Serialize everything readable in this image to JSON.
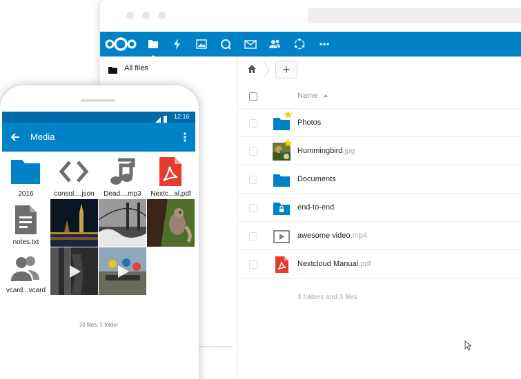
{
  "desktop": {
    "header_icons": [
      "nextcloud-logo",
      "files-icon",
      "activity-icon",
      "gallery-icon",
      "talk-icon",
      "mail-icon",
      "contacts-icon",
      "circles-icon",
      "more-icon"
    ],
    "sidebar": {
      "items": [
        {
          "label": "All files",
          "icon": "folder-icon"
        }
      ]
    },
    "controls": {
      "add_label": "+"
    },
    "file_list": {
      "name_column": "Name",
      "files": [
        {
          "name": "Photos",
          "ext": "",
          "type": "folder",
          "favorite": true
        },
        {
          "name": "Hummingbird",
          "ext": ".jpg",
          "type": "image",
          "favorite": true
        },
        {
          "name": "Documents",
          "ext": "",
          "type": "folder",
          "favorite": false
        },
        {
          "name": "end-to-end",
          "ext": "",
          "type": "encrypted-folder",
          "favorite": false
        },
        {
          "name": "awesome video",
          "ext": ".mp4",
          "type": "video",
          "favorite": false
        },
        {
          "name": "Nextcloud Manual",
          "ext": ".pdf",
          "type": "pdf",
          "favorite": false
        }
      ],
      "summary": "3 folders and 3 files"
    }
  },
  "phone": {
    "status_time": "12:16",
    "title": "Media",
    "tiles": [
      {
        "label": "2016",
        "icon": "folder-icon"
      },
      {
        "label": "consol....json",
        "icon": "code-icon"
      },
      {
        "label": "Dead....mp3",
        "icon": "music-icon"
      },
      {
        "label": "Nextc...al.pdf",
        "icon": "pdf-icon"
      },
      {
        "label": "notes.txt",
        "icon": "text-file-icon"
      },
      {
        "label": "vcard...vcard",
        "icon": "contacts-icon"
      }
    ],
    "summary": "10 files, 1 folder"
  },
  "colors": {
    "brand": "#0082c9",
    "statusbar": "#006ba9",
    "favorite": "#fc0",
    "pdf": "#e53c2e"
  }
}
